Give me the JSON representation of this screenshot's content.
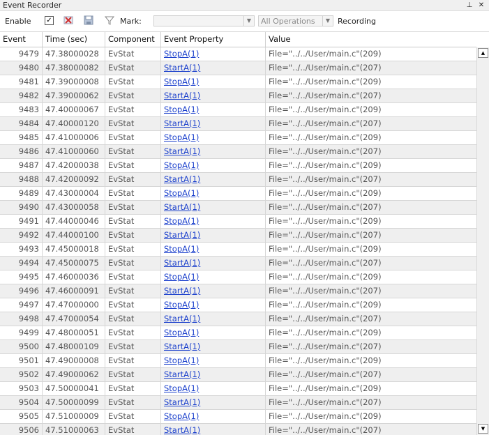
{
  "window": {
    "title": "Event Recorder",
    "pin_glyph": "⊥",
    "close_glyph": "✕"
  },
  "toolbar": {
    "enable_label": "Enable",
    "enable_checked": "✓",
    "mark_label": "Mark:",
    "mark_value": "",
    "operations_value": "All Operations",
    "recording_label": "Recording"
  },
  "columns": [
    "Event",
    "Time (sec)",
    "Component",
    "Event Property",
    "Value"
  ],
  "rows": [
    {
      "event": "9479",
      "time": "47.38000028",
      "component": "EvStat",
      "property": "StopA(1)",
      "value": "File=\"../../User/main.c\"(209)"
    },
    {
      "event": "9480",
      "time": "47.38000082",
      "component": "EvStat",
      "property": "StartA(1)",
      "value": "File=\"../../User/main.c\"(207)"
    },
    {
      "event": "9481",
      "time": "47.39000008",
      "component": "EvStat",
      "property": "StopA(1)",
      "value": "File=\"../../User/main.c\"(209)"
    },
    {
      "event": "9482",
      "time": "47.39000062",
      "component": "EvStat",
      "property": "StartA(1)",
      "value": "File=\"../../User/main.c\"(207)"
    },
    {
      "event": "9483",
      "time": "47.40000067",
      "component": "EvStat",
      "property": "StopA(1)",
      "value": "File=\"../../User/main.c\"(209)"
    },
    {
      "event": "9484",
      "time": "47.40000120",
      "component": "EvStat",
      "property": "StartA(1)",
      "value": "File=\"../../User/main.c\"(207)"
    },
    {
      "event": "9485",
      "time": "47.41000006",
      "component": "EvStat",
      "property": "StopA(1)",
      "value": "File=\"../../User/main.c\"(209)"
    },
    {
      "event": "9486",
      "time": "47.41000060",
      "component": "EvStat",
      "property": "StartA(1)",
      "value": "File=\"../../User/main.c\"(207)"
    },
    {
      "event": "9487",
      "time": "47.42000038",
      "component": "EvStat",
      "property": "StopA(1)",
      "value": "File=\"../../User/main.c\"(209)"
    },
    {
      "event": "9488",
      "time": "47.42000092",
      "component": "EvStat",
      "property": "StartA(1)",
      "value": "File=\"../../User/main.c\"(207)"
    },
    {
      "event": "9489",
      "time": "47.43000004",
      "component": "EvStat",
      "property": "StopA(1)",
      "value": "File=\"../../User/main.c\"(209)"
    },
    {
      "event": "9490",
      "time": "47.43000058",
      "component": "EvStat",
      "property": "StartA(1)",
      "value": "File=\"../../User/main.c\"(207)"
    },
    {
      "event": "9491",
      "time": "47.44000046",
      "component": "EvStat",
      "property": "StopA(1)",
      "value": "File=\"../../User/main.c\"(209)"
    },
    {
      "event": "9492",
      "time": "47.44000100",
      "component": "EvStat",
      "property": "StartA(1)",
      "value": "File=\"../../User/main.c\"(207)"
    },
    {
      "event": "9493",
      "time": "47.45000018",
      "component": "EvStat",
      "property": "StopA(1)",
      "value": "File=\"../../User/main.c\"(209)"
    },
    {
      "event": "9494",
      "time": "47.45000075",
      "component": "EvStat",
      "property": "StartA(1)",
      "value": "File=\"../../User/main.c\"(207)"
    },
    {
      "event": "9495",
      "time": "47.46000036",
      "component": "EvStat",
      "property": "StopA(1)",
      "value": "File=\"../../User/main.c\"(209)"
    },
    {
      "event": "9496",
      "time": "47.46000091",
      "component": "EvStat",
      "property": "StartA(1)",
      "value": "File=\"../../User/main.c\"(207)"
    },
    {
      "event": "9497",
      "time": "47.47000000",
      "component": "EvStat",
      "property": "StopA(1)",
      "value": "File=\"../../User/main.c\"(209)"
    },
    {
      "event": "9498",
      "time": "47.47000054",
      "component": "EvStat",
      "property": "StartA(1)",
      "value": "File=\"../../User/main.c\"(207)"
    },
    {
      "event": "9499",
      "time": "47.48000051",
      "component": "EvStat",
      "property": "StopA(1)",
      "value": "File=\"../../User/main.c\"(209)"
    },
    {
      "event": "9500",
      "time": "47.48000109",
      "component": "EvStat",
      "property": "StartA(1)",
      "value": "File=\"../../User/main.c\"(207)"
    },
    {
      "event": "9501",
      "time": "47.49000008",
      "component": "EvStat",
      "property": "StopA(1)",
      "value": "File=\"../../User/main.c\"(209)"
    },
    {
      "event": "9502",
      "time": "47.49000062",
      "component": "EvStat",
      "property": "StartA(1)",
      "value": "File=\"../../User/main.c\"(207)"
    },
    {
      "event": "9503",
      "time": "47.50000041",
      "component": "EvStat",
      "property": "StopA(1)",
      "value": "File=\"../../User/main.c\"(209)"
    },
    {
      "event": "9504",
      "time": "47.50000099",
      "component": "EvStat",
      "property": "StartA(1)",
      "value": "File=\"../../User/main.c\"(207)"
    },
    {
      "event": "9505",
      "time": "47.51000009",
      "component": "EvStat",
      "property": "StopA(1)",
      "value": "File=\"../../User/main.c\"(209)"
    },
    {
      "event": "9506",
      "time": "47.51000063",
      "component": "EvStat",
      "property": "StartA(1)",
      "value": "File=\"../../User/main.c\"(207)"
    }
  ],
  "colors": {
    "link": "#1a3fcc",
    "alt_row": "#efefef",
    "grid": "#d6d6d6"
  },
  "icons": [
    "pin-icon",
    "close-icon",
    "clear-icon",
    "save-icon",
    "filter-icon",
    "scroll-up-icon",
    "scroll-down-icon"
  ],
  "scrollbar": {
    "up_glyph": "▲",
    "down_glyph": "▼"
  }
}
